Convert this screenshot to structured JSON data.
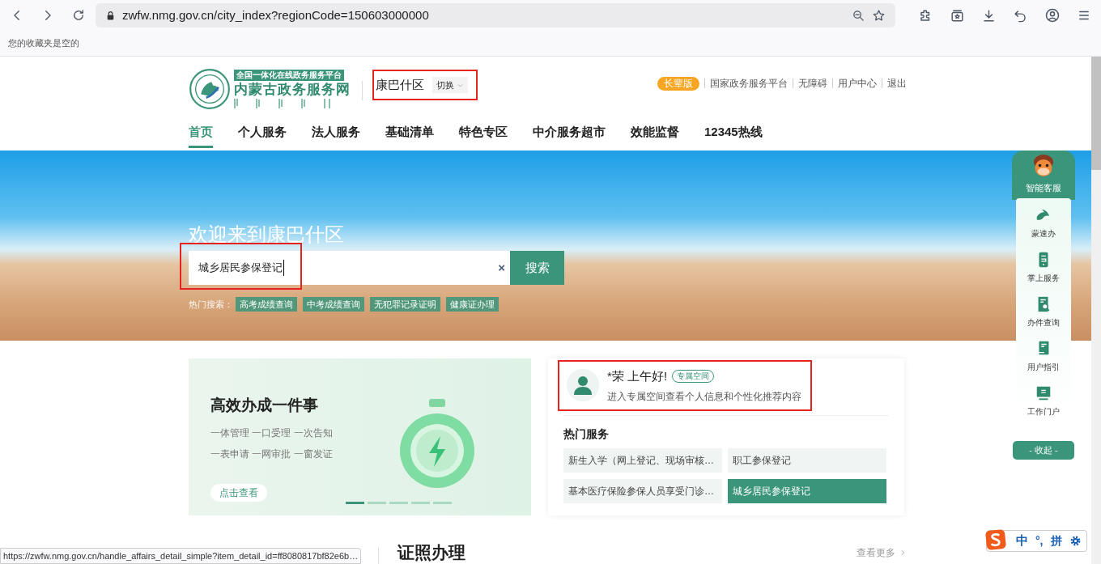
{
  "browser": {
    "url": "zwfw.nmg.gov.cn/city_index?regionCode=150603000000",
    "bookmarks_empty": "您的收藏夹是空的",
    "status_url": "https://zwfw.nmg.gov.cn/handle_affairs_detail_simple?item_detail_id=ff8080817bf82e6b…"
  },
  "header": {
    "logo_tagline": "全国一体化在线政务服务平台",
    "logo_title": "内蒙古政务服务网",
    "region": "康巴什区",
    "switch": "切换",
    "elder_mode": "长辈版",
    "links": [
      "国家政务服务平台",
      "无障碍",
      "用户中心",
      "退出"
    ]
  },
  "nav": [
    {
      "label": "首页",
      "selected": true
    },
    {
      "label": "个人服务",
      "selected": false
    },
    {
      "label": "法人服务",
      "selected": false
    },
    {
      "label": "基础清单",
      "selected": false
    },
    {
      "label": "特色专区",
      "selected": false
    },
    {
      "label": "中介服务超市",
      "selected": false
    },
    {
      "label": "效能监督",
      "selected": false
    },
    {
      "label": "12345热线",
      "selected": false
    }
  ],
  "banner": {
    "welcome": "欢迎来到康巴什区",
    "search_value": "城乡居民参保登记",
    "clear": "×",
    "search_button": "搜索",
    "hot_label": "热门搜索：",
    "hot": [
      "高考成绩查询",
      "中考成绩查询",
      "无犯罪记录证明",
      "健康证办理"
    ]
  },
  "promo": {
    "title": "高效办成一件事",
    "lines": [
      "一体管理 一口受理 一次告知",
      "一表申请 一网审批 一窗发证"
    ],
    "button": "点击查看",
    "dots": [
      {
        "selected": true
      },
      {
        "selected": false
      },
      {
        "selected": false
      },
      {
        "selected": false
      },
      {
        "selected": false
      }
    ]
  },
  "user": {
    "greeting": "*荣 上午好!",
    "space_tag": "专属空间",
    "subtitle": "进入专属空间查看个人信息和个性化推荐内容"
  },
  "hot_services": {
    "title": "热门服务",
    "items": [
      {
        "label": "新生入学（网上登记、现场审核…",
        "selected": false
      },
      {
        "label": "职工参保登记",
        "selected": false
      },
      {
        "label": "基本医疗保险参保人员享受门诊…",
        "selected": false
      },
      {
        "label": "城乡居民参保登记",
        "selected": true
      }
    ]
  },
  "side_panel": {
    "title": "智能客服",
    "items": [
      {
        "label": "蒙速办",
        "kind": "bird"
      },
      {
        "label": "掌上服务",
        "kind": "phone"
      },
      {
        "label": "办件查询",
        "kind": "search"
      },
      {
        "label": "用户指引",
        "kind": "guide"
      },
      {
        "label": "工作门户",
        "kind": "monitor"
      }
    ],
    "collapse": "- 收起 -"
  },
  "section": {
    "tab": "证照办理",
    "more": "查看更多"
  },
  "ime": {
    "lang": "中",
    "punct": "°,",
    "mode": "拼"
  }
}
